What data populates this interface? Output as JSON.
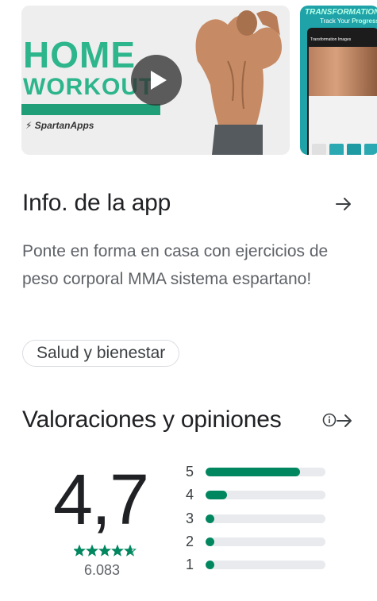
{
  "media": {
    "video": {
      "title_line1": "HOME",
      "title_line2": "WORKOUT",
      "brand": "SpartanApps"
    },
    "screenshot": {
      "title": "TRANSFORMATION IMAGES",
      "subtitle_prefix": "Track Your",
      "subtitle_accent": "Progress",
      "phone_header": "Transformation Images"
    }
  },
  "info": {
    "title": "Info. de la app",
    "description": "Ponte en forma en casa con ejercicios de peso corporal MMA sistema espartano!",
    "category_chip": "Salud y bienestar"
  },
  "ratings": {
    "title": "Valoraciones y opiniones",
    "average": "4,7",
    "star_level": 0.94,
    "review_count": "6.083",
    "distribution": [
      {
        "label": "5",
        "fraction": 0.79
      },
      {
        "label": "4",
        "fraction": 0.18
      },
      {
        "label": "3",
        "fraction": 0.04
      },
      {
        "label": "2",
        "fraction": 0.03
      },
      {
        "label": "1",
        "fraction": 0.04
      }
    ]
  },
  "colors": {
    "accent_green": "#01875f",
    "brand_green": "#2db58c",
    "text_primary": "#202124",
    "text_secondary": "#5f6368",
    "track": "#e8eaed"
  }
}
